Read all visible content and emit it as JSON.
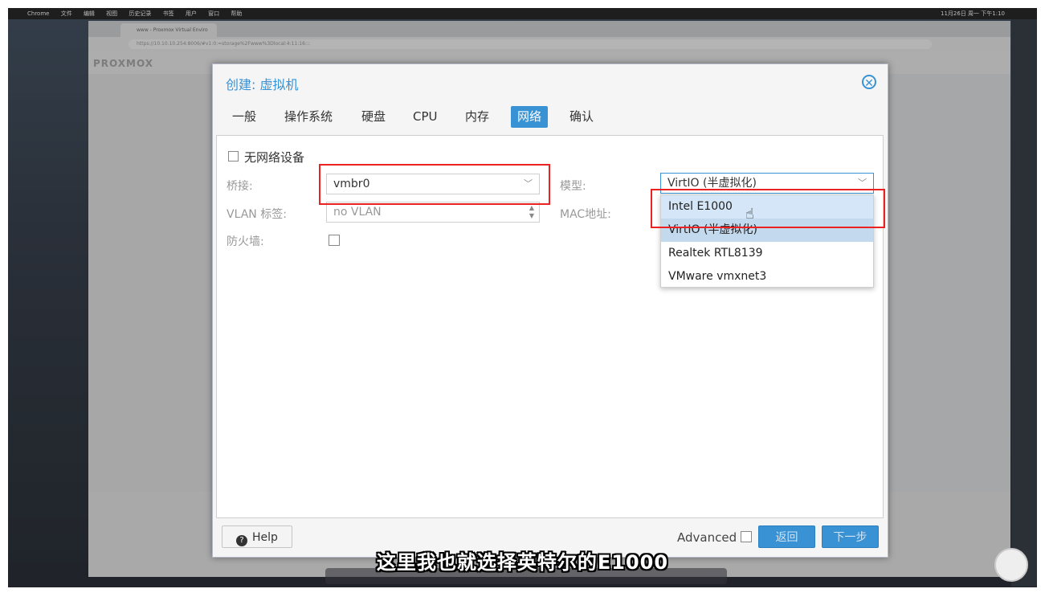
{
  "mac_menubar": {
    "items": [
      "Chrome",
      "文件",
      "编辑",
      "视图",
      "历史记录",
      "书签",
      "用户",
      "窗口",
      "帮助"
    ],
    "clock": "11月26日 周一 下午1:10"
  },
  "browser": {
    "tab_title": "www - Proxmox Virtual Enviro",
    "url": "https://10.10.10.254:8006/#v1:0:=storage%2Fwww%3Dlocal:4:11:16:::"
  },
  "pve": {
    "logo": "PROXMOX"
  },
  "dialog": {
    "title": "创建: 虚拟机",
    "tabs": [
      "一般",
      "操作系统",
      "硬盘",
      "CPU",
      "内存",
      "网络",
      "确认"
    ],
    "active_tab": "网络",
    "no_network_label": "无网络设备",
    "bridge_label": "桥接:",
    "bridge_value": "vmbr0",
    "vlan_label": "VLAN 标签:",
    "vlan_placeholder": "no VLAN",
    "firewall_label": "防火墙:",
    "model_label": "模型:",
    "model_value": "VirtIO (半虚拟化)",
    "mac_label": "MAC地址:",
    "model_options": [
      "Intel E1000",
      "VirtIO (半虚拟化)",
      "Realtek RTL8139",
      "VMware vmxnet3"
    ],
    "help_label": "Help",
    "advanced_label": "Advanced",
    "back_label": "返回",
    "next_label": "下一步"
  },
  "subtitle": "这里我也就选择英特尔的E1000",
  "colors": {
    "accent": "#3892d4",
    "annotation_red": "#ec2222"
  }
}
